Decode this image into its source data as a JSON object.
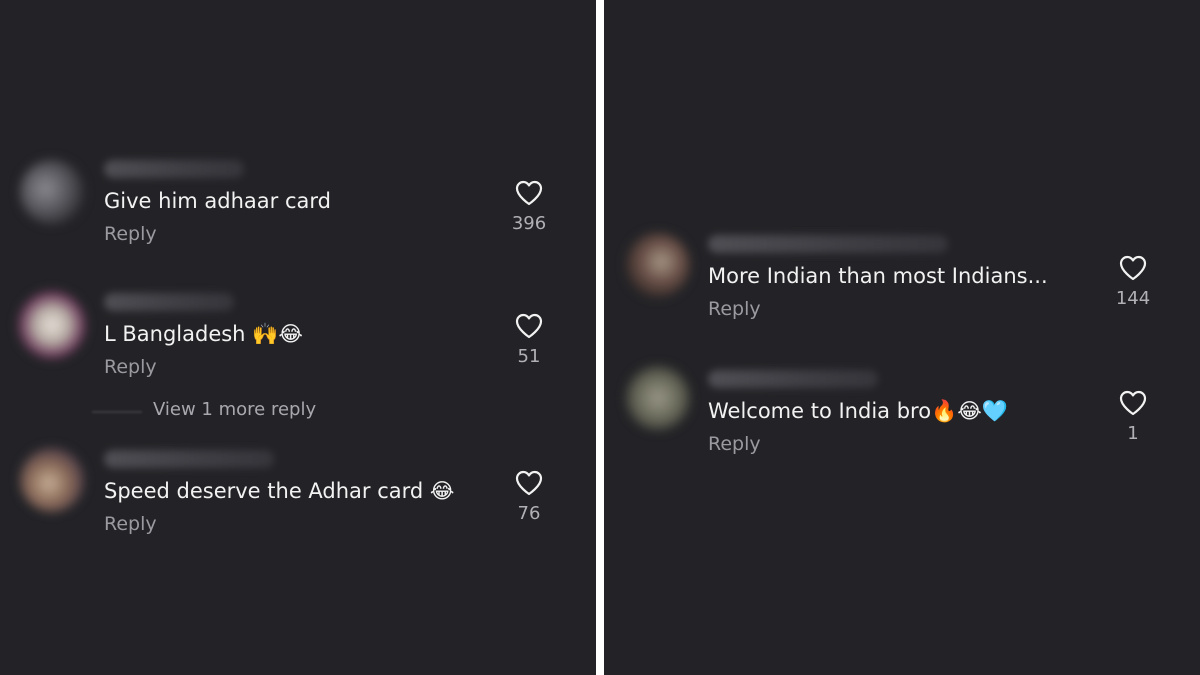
{
  "left_panel": {
    "comments": [
      {
        "text": "Give him adhaar card",
        "reply": "Reply",
        "likes": "396"
      },
      {
        "text": "L Bangladesh 🙌😂",
        "reply": "Reply",
        "likes": "51",
        "view_more": "View 1 more reply"
      },
      {
        "text": "Speed deserve the Adhar card 😂",
        "reply": "Reply",
        "likes": "76"
      }
    ]
  },
  "right_panel": {
    "comments": [
      {
        "text": "More Indian than most Indians...",
        "reply": "Reply",
        "likes": "144"
      },
      {
        "text": "Welcome to India bro🔥😂🩵",
        "reply": "Reply",
        "likes": "1"
      }
    ]
  },
  "colors": {
    "background": "#232327",
    "divider": "#ffffff",
    "text": "#f2f2f2",
    "muted": "#9a9aa0"
  },
  "icons": {
    "like": "heart-outline-icon"
  }
}
